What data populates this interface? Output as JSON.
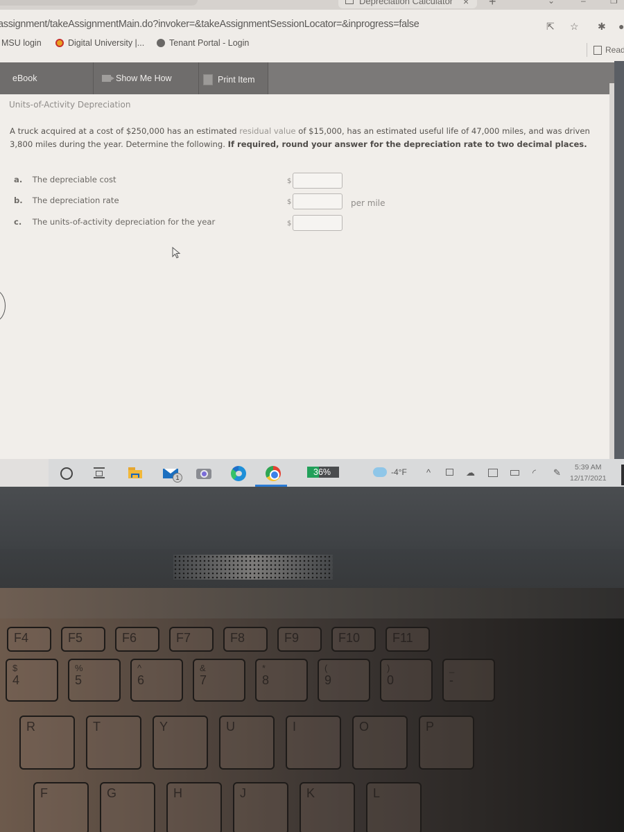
{
  "browser": {
    "active_tab": {
      "title": "Depreciation Calculator",
      "icon": "calculator-icon"
    },
    "url": "assignment/takeAssignmentMain.do?invoker=&takeAssignmentSessionLocator=&inprogress=false",
    "address_icons": [
      "share-icon",
      "star-icon",
      "extensions-icon",
      "profile-icon"
    ],
    "bookmarks": [
      {
        "label": "MSU login",
        "icon": "none"
      },
      {
        "label": "Digital University |...",
        "icon": "digital-university-icon"
      },
      {
        "label": "Tenant Portal - Login",
        "icon": "globe-icon"
      }
    ],
    "reading_list": "Read"
  },
  "toolbar": {
    "items": [
      {
        "label": "eBook",
        "icon": "book-icon"
      },
      {
        "label": "Show Me How",
        "icon": "video-icon"
      },
      {
        "label": "Print Item",
        "icon": "print-icon"
      }
    ]
  },
  "problem": {
    "title": "Units-of-Activity Depreciation",
    "text_part1": "A truck acquired at a cost of $250,000 has an estimated ",
    "text_muted": "residual value",
    "text_part2": " of $15,000, has an estimated useful life of 47,000 miles, and was driven 3,800 miles during the year. Determine the following. ",
    "instruction_bold": "If required, round your answer for the depreciation rate to two decimal places.",
    "questions": [
      {
        "letter": "a.",
        "label": "The depreciable cost",
        "currency": "$",
        "value": "",
        "unit": ""
      },
      {
        "letter": "b.",
        "label": "The depreciation rate",
        "currency": "$",
        "value": "",
        "unit": "per mile"
      },
      {
        "letter": "c.",
        "label": "The units-of-activity depreciation for the year",
        "currency": "$",
        "value": "",
        "unit": ""
      }
    ]
  },
  "taskbar": {
    "pinned": [
      "search-icon",
      "task-view-icon",
      "file-explorer-icon",
      "mail-icon",
      "camera-icon",
      "edge-icon",
      "chrome-icon"
    ],
    "mail_badge": "1",
    "battery_label": "36%",
    "battery_percent": 36,
    "weather": "-4°F",
    "time": "5:39 AM",
    "date": "12/17/2021"
  },
  "keyboard": {
    "fn_row": [
      "F4",
      "F5",
      "F6",
      "F7",
      "F8",
      "F9",
      "F10",
      "F11"
    ],
    "number_row": [
      {
        "top": "$",
        "bot": "4"
      },
      {
        "top": "%",
        "bot": "5"
      },
      {
        "top": "^",
        "bot": "6"
      },
      {
        "top": "&",
        "bot": "7"
      },
      {
        "top": "*",
        "bot": "8"
      },
      {
        "top": "(",
        "bot": "9"
      },
      {
        "top": ")",
        "bot": "0"
      },
      {
        "top": "_",
        "bot": "-"
      }
    ],
    "top_row": [
      "R",
      "T",
      "Y",
      "U",
      "I",
      "O",
      "P"
    ],
    "home_row": [
      "F",
      "G",
      "H",
      "J",
      "K",
      "L"
    ]
  }
}
